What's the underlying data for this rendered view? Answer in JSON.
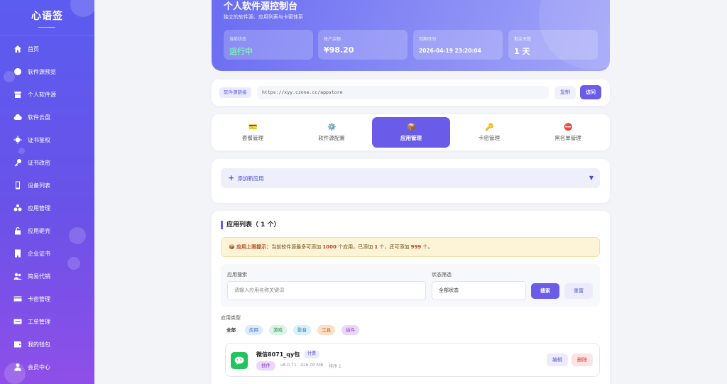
{
  "sidebar": {
    "logo": "心语签",
    "items": [
      {
        "label": "首页",
        "icon": "home-icon"
      },
      {
        "label": "软件源预览",
        "icon": "globe-icon"
      },
      {
        "label": "个人软件源",
        "icon": "store-icon"
      },
      {
        "label": "软件云盘",
        "icon": "cloud-icon"
      },
      {
        "label": "证书鉴权",
        "icon": "certificate-icon"
      },
      {
        "label": "证书改密",
        "icon": "key-icon"
      },
      {
        "label": "设备列表",
        "icon": "phone-icon"
      },
      {
        "label": "应用管理",
        "icon": "apps-icon"
      },
      {
        "label": "应用砸壳",
        "icon": "unlock-icon"
      },
      {
        "label": "企业证书",
        "icon": "building-icon"
      },
      {
        "label": "简易代销",
        "icon": "users-icon"
      },
      {
        "label": "卡密管理",
        "icon": "card-icon"
      },
      {
        "label": "工单管理",
        "icon": "ticket-icon"
      },
      {
        "label": "我的钱包",
        "icon": "wallet-icon"
      },
      {
        "label": "会员中心",
        "icon": "member-icon"
      }
    ]
  },
  "hero": {
    "title": "个人软件源控制台",
    "subtitle": "独立的软件源、应用列表与卡密体系",
    "stats": [
      {
        "label": "当前状态",
        "value": "运行中"
      },
      {
        "label": "账户余额",
        "value": "¥98.20"
      },
      {
        "label": "到期时间",
        "value": "2026-04-19 23:20:04"
      },
      {
        "label": "剩余天数",
        "value": "1 天"
      }
    ],
    "status_color": "#7cf2b3"
  },
  "source": {
    "tag": "软件源链接",
    "url": "https://xyy.czone.cc/appstore",
    "copy_label": "复制",
    "visit_label": "访问"
  },
  "tabs": [
    {
      "label": "套餐管理",
      "icon": "card-icon",
      "glyph": "💳"
    },
    {
      "label": "软件源配置",
      "icon": "gear-icon",
      "glyph": "⚙️"
    },
    {
      "label": "应用管理",
      "icon": "package-icon",
      "glyph": "📦"
    },
    {
      "label": "卡密管理",
      "icon": "key-icon",
      "glyph": "🔑"
    },
    {
      "label": "黑名单管理",
      "icon": "block-icon",
      "glyph": "⛔"
    }
  ],
  "add_app": {
    "label": "添加新应用",
    "caret": "▼"
  },
  "app_list": {
    "title": "应用列表（ 1 个）",
    "notice": {
      "prefix": "📦 应用上限提示：",
      "t1": "当前软件源最多可添加 ",
      "max": "1000",
      "t2": " 个应用，已添加 ",
      "added": "1",
      "t3": " 个，还可添加 ",
      "remain": "999",
      "t4": " 个。"
    },
    "search_label": "应用搜索",
    "search_placeholder": "请输入应用名称关键词",
    "status_label": "状态筛选",
    "status_value": "全部状态",
    "search_btn": "搜索",
    "reset_btn": "重置",
    "type_label": "应用类型",
    "types": [
      "全部",
      "应用",
      "游戏",
      "影音",
      "工具",
      "插件"
    ],
    "apps": [
      {
        "name": "微信8071_qy包",
        "badge": "付费",
        "category": "插件",
        "version": "v8.0.71",
        "size": "426.00 MB",
        "order": "排序 1",
        "edit": "编辑",
        "delete": "删除"
      }
    ]
  }
}
